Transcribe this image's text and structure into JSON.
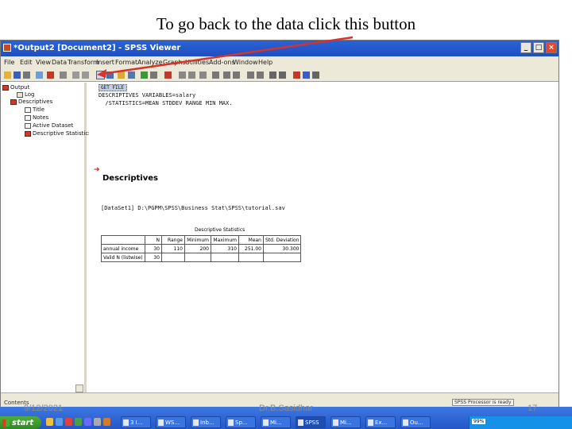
{
  "caption": "To go back to the data click this button",
  "window": {
    "title": "*Output2 [Document2] - SPSS Viewer",
    "controls": [
      "_",
      "□",
      "×"
    ]
  },
  "menu": [
    "File",
    "Edit",
    "View",
    "Data",
    "Transform",
    "Insert",
    "Format",
    "Analyze",
    "Graphs",
    "Utilities",
    "Add-ons",
    "Window",
    "Help"
  ],
  "outline": {
    "items": [
      {
        "label": "Output",
        "icon": "book-icon"
      },
      {
        "label": "Log",
        "icon": "log-icon"
      },
      {
        "label": "Descriptives",
        "icon": "book-icon"
      },
      {
        "label": "Title",
        "icon": "title-icon"
      },
      {
        "label": "Notes",
        "icon": "notes-icon"
      },
      {
        "label": "Active Dataset",
        "icon": "dataset-icon"
      },
      {
        "label": "Descriptive Statistics",
        "icon": "table-icon"
      }
    ]
  },
  "viewer": {
    "selected_label": "GET FILE",
    "syntax_line1": "DESCRIPTIVES VARIABLES=salary",
    "syntax_line2": "  /STATISTICS=MEAN STDDEV RANGE MIN MAX.",
    "heading": "Descriptives",
    "dataset_line": "[DataSet1] D:\\PGPM\\SPSS\\Business Stat\\SPSS\\tutorial.sav",
    "table_title": "Descriptive Statistics",
    "table": {
      "headers": [
        "",
        "N",
        "Range",
        "Minimum",
        "Maximum",
        "Mean",
        "Std. Deviation"
      ],
      "rows": [
        [
          "annual income",
          "30",
          "110",
          "200",
          "310",
          "251.00",
          "30.300"
        ],
        [
          "Valid N (listwise)",
          "30",
          "",
          "",
          "",
          "",
          ""
        ]
      ]
    }
  },
  "status": {
    "left": "Contents",
    "processor": "SPSS Processor is ready"
  },
  "taskbar": {
    "start": "start",
    "tasks": [
      "3 I...",
      "WS...",
      "Inb...",
      "Sp...",
      "Mi...",
      "SPSS",
      "Mi...",
      "Ex...",
      "Ou..."
    ],
    "indicator": "99%"
  },
  "footer": {
    "date": "9/12/2021",
    "author": "Dr.B.Sasidhar",
    "page": "17"
  },
  "colors": {
    "arrow": "#d8322a",
    "titlebar": "#2a63d6",
    "taskbar": "#2456c7"
  }
}
